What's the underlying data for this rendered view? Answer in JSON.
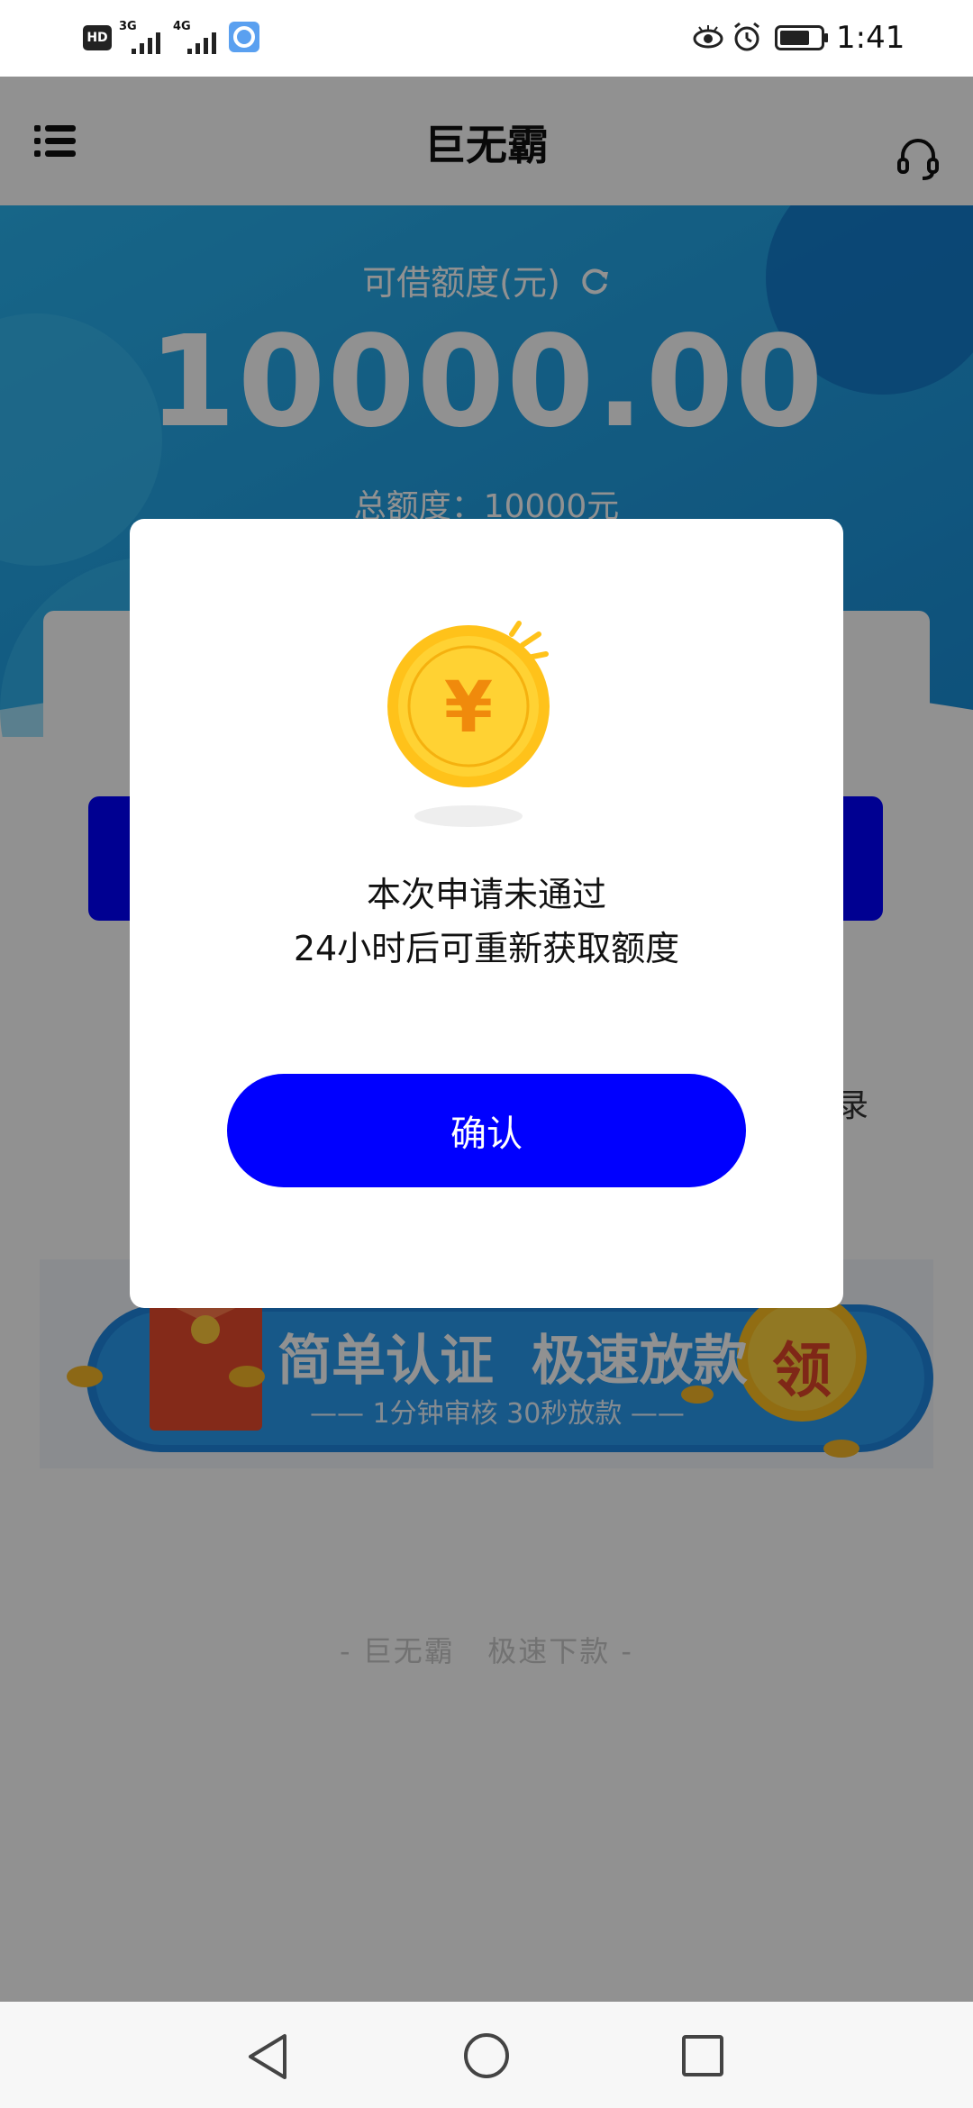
{
  "status_bar": {
    "network_badges": [
      "HD",
      "3G",
      "4G"
    ],
    "time": "1:41",
    "icons": [
      "hd-icon",
      "signal-icon",
      "signal-icon",
      "browser-app-icon",
      "eye-comfort-icon",
      "alarm-icon",
      "battery-icon"
    ]
  },
  "header": {
    "title": "巨无霸",
    "menu_icon": "list-menu-icon",
    "service_icon": "headset-icon"
  },
  "hero": {
    "credit_label": "可借额度(元)",
    "refresh_icon": "refresh-icon",
    "credit_amount": "10000.00",
    "total_amount": "总额度：10000元"
  },
  "card": {
    "record_text": "录"
  },
  "banner": {
    "headline": "简单认证  极速放款",
    "subline": "—— 1分钟审核 30秒放款 ——",
    "badge": "领"
  },
  "footer": {
    "slogan": "- 巨无霸   极速下款 -"
  },
  "dialog": {
    "icon": "gold-yuan-coin-icon",
    "coin_symbol": "¥",
    "line1": "本次申请未通过",
    "line2": "24小时后可重新获取额度",
    "confirm_label": "确认"
  },
  "nav_bar": {
    "icons": [
      "back-triangle-icon",
      "home-circle-icon",
      "recents-square-icon"
    ]
  },
  "colors": {
    "primary_blue": "#0000ff",
    "hero_blue": "#1da0e6",
    "overlay": "rgba(0,0,0,0.43)"
  }
}
